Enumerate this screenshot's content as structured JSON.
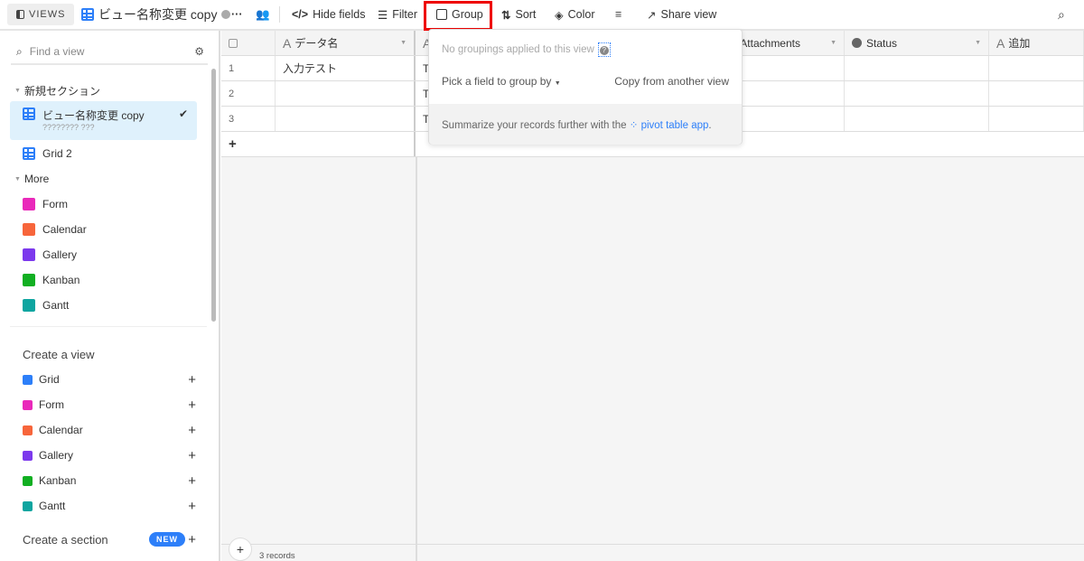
{
  "toolbar": {
    "views_label": "VIEWS",
    "view_name": "ビュー名称変更 copy",
    "hide_fields": "Hide fields",
    "filter": "Filter",
    "group": "Group",
    "sort": "Sort",
    "color": "Color",
    "share_view": "Share view"
  },
  "sidebar": {
    "search_placeholder": "Find a view",
    "section1": "新規セクション",
    "selected_view": {
      "name": "ビュー名称変更 copy",
      "subtitle": "???????? ???"
    },
    "grid2": "Grid 2",
    "section2": "More",
    "more_items": [
      {
        "label": "Form",
        "color": "#e929ba"
      },
      {
        "label": "Calendar",
        "color": "#f7653b"
      },
      {
        "label": "Gallery",
        "color": "#7c39ed"
      },
      {
        "label": "Kanban",
        "color": "#11af22"
      },
      {
        "label": "Gantt",
        "color": "#0ea5a0"
      }
    ],
    "create_view_title": "Create a view",
    "create_items": [
      {
        "label": "Grid",
        "color": "#2d7ff9"
      },
      {
        "label": "Form",
        "color": "#e929ba"
      },
      {
        "label": "Calendar",
        "color": "#f7653b"
      },
      {
        "label": "Gallery",
        "color": "#7c39ed"
      },
      {
        "label": "Kanban",
        "color": "#11af22"
      },
      {
        "label": "Gantt",
        "color": "#0ea5a0"
      }
    ],
    "create_section": "Create a section",
    "new_badge": "NEW"
  },
  "grid": {
    "columns": [
      "データ名",
      "",
      "Attachments",
      "Status",
      "追加"
    ],
    "attachments_visible": "chments",
    "rows": [
      {
        "num": "1",
        "name": "入力テスト",
        "col2": "TE"
      },
      {
        "num": "2",
        "name": "",
        "col2": "TE"
      },
      {
        "num": "3",
        "name": "",
        "col2": "TE"
      }
    ],
    "add_row": "+",
    "record_count": "3 records"
  },
  "group_popover": {
    "empty_text": "No groupings applied to this view",
    "help": "?",
    "pick_field": "Pick a field to group by",
    "copy_view": "Copy from another view",
    "summary_prefix": "Summarize your records further with the",
    "summary_link": "pivot table app",
    "summary_suffix": "."
  },
  "colors": {
    "accent": "#2d7ff9",
    "highlight": "#ee0000",
    "selected_bg": "#dff1fc"
  }
}
